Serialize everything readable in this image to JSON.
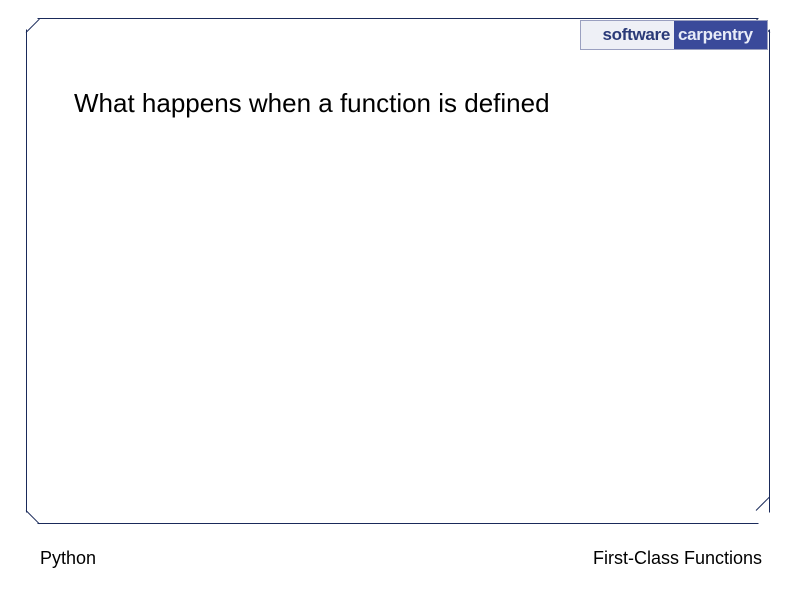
{
  "logo": {
    "left": "software",
    "right": "carpentry"
  },
  "heading": "What happens when a function is defined",
  "footer": {
    "left": "Python",
    "right": "First-Class Functions"
  }
}
